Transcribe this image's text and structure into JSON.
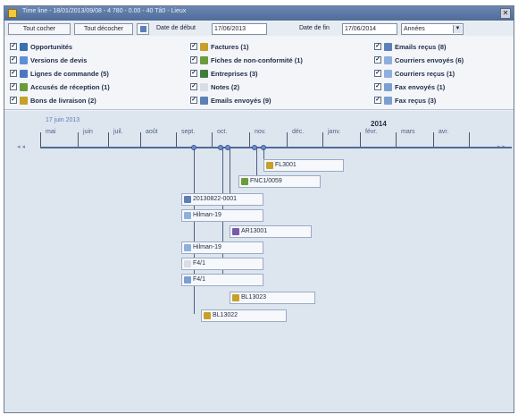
{
  "window": {
    "title": "Time line - 18/01/2013/09/08 - 4 780 - 0.00 - 40 Tâ0 - Lieux",
    "close_glyph": "✕"
  },
  "toolbar": {
    "btn_all_shown": "Tout cocher",
    "btn_all_hidden": "Tout décocher",
    "btn_filter_icon": "filter-icon",
    "start_label": "Date de début",
    "start_value": "17/06/2013",
    "end_label": "Date de fin",
    "end_value": "17/06/2014",
    "scale_value": "Années",
    "scale_arrow": "▼"
  },
  "filters": {
    "check_mark": "✓",
    "columns": [
      [
        {
          "label": "Opportunités",
          "icon_color": "#3a6fb0"
        },
        {
          "label": "Versions de devis",
          "icon_color": "#5c8fd6"
        },
        {
          "label": "Lignes de commande (5)",
          "icon_color": "#4a78c0"
        },
        {
          "label": "Accusés de réception (1)",
          "icon_color": "#6b9b3c"
        },
        {
          "label": "Bons de livraison (2)",
          "icon_color": "#c8a029"
        }
      ],
      [
        {
          "label": "Factures (1)",
          "icon_color": "#c8a029"
        },
        {
          "label": "Fiches de non-conformité (1)",
          "icon_color": "#6b9b3c"
        },
        {
          "label": "Entreprises (3)",
          "icon_color": "#3f7d3f"
        },
        {
          "label": "Notes (2)",
          "icon_color": "#d8dde6"
        },
        {
          "label": "Emails envoyés (9)",
          "icon_color": "#5d7fb8"
        }
      ],
      [
        {
          "label": "Emails reçus (8)",
          "icon_color": "#5d7fb8"
        },
        {
          "label": "Courriers envoyés (6)",
          "icon_color": "#8eb0dc"
        },
        {
          "label": "Courriers reçus (1)",
          "icon_color": "#8eb0dc"
        },
        {
          "label": "Fax envoyés (1)",
          "icon_color": "#7b9fd0"
        },
        {
          "label": "Fax reçus (3)",
          "icon_color": "#7b9fd0"
        }
      ]
    ]
  },
  "timeline": {
    "date_label": "17 juin 2013",
    "year_label": "2014",
    "left_arrows": "◂ ◂",
    "right_arrows": "▸ ▸",
    "months": [
      "mai",
      "juin",
      "juil.",
      "août",
      "sept.",
      "oct.",
      "nov.",
      "déc.",
      "janv.",
      "févr.",
      "mars",
      "avr."
    ],
    "events": [
      {
        "label": "FL3001",
        "icon_color": "#c8a029"
      },
      {
        "label": "FNC1/0059",
        "icon_color": "#6b9b3c"
      },
      {
        "label": "20130822-0001",
        "icon_color": "#5d7fb8"
      },
      {
        "label": "Hilman-19",
        "icon_color": "#8eb0dc"
      },
      {
        "label": "AR13001",
        "icon_color": "#7a5aa8"
      },
      {
        "label": "Hilman-19",
        "icon_color": "#8eb0dc"
      },
      {
        "label": "F4/1",
        "icon_color": "#d8dde6"
      },
      {
        "label": "F4/1",
        "icon_color": "#7b9fd0"
      },
      {
        "label": "BL13023",
        "icon_color": "#c8a029"
      },
      {
        "label": "BL13022",
        "icon_color": "#c8a029"
      }
    ]
  }
}
